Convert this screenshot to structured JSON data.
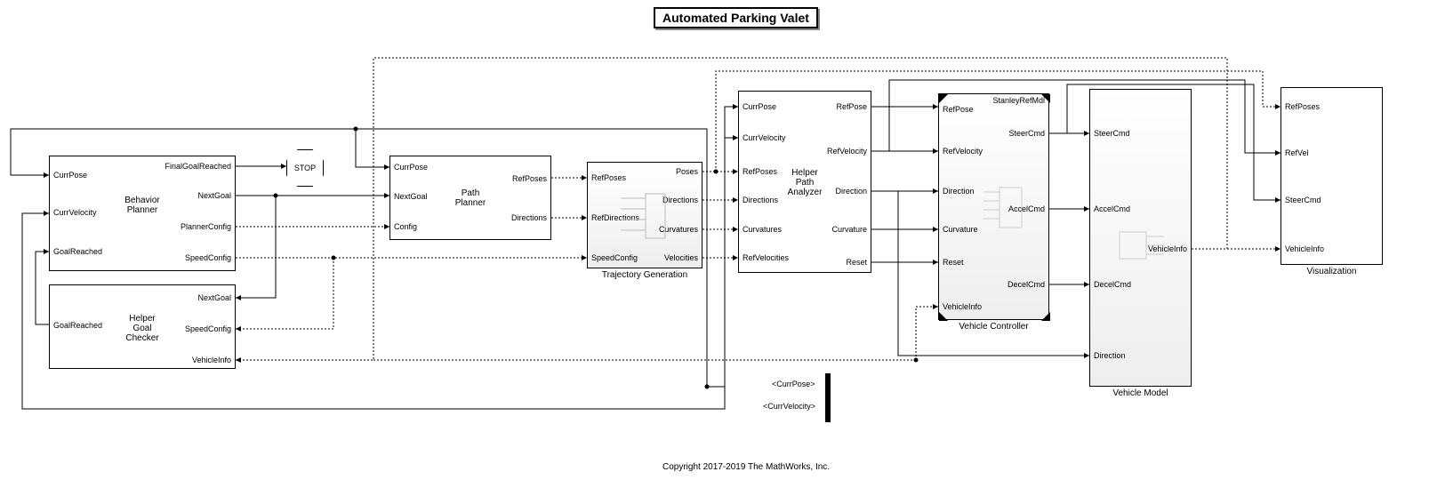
{
  "title": "Automated Parking Valet",
  "copyright": "Copyright 2017-2019 The MathWorks, Inc.",
  "stop": "STOP",
  "bussel": {
    "currpose": "<CurrPose>",
    "currvel": "<CurrVelocity>"
  },
  "blocks": {
    "behavior": {
      "name": "Behavior\nPlanner",
      "in": [
        "CurrPose",
        "CurrVelocity",
        "GoalReached"
      ],
      "out": [
        "FinalGoalReached",
        "NextGoal",
        "PlannerConfig",
        "SpeedConfig"
      ]
    },
    "goalchecker": {
      "name": "Helper\nGoal\nChecker",
      "in": [
        "GoalReached"
      ],
      "out": [
        "NextGoal",
        "SpeedConfig",
        "VehicleInfo"
      ]
    },
    "pathplanner": {
      "name": "Path\nPlanner",
      "in": [
        "CurrPose",
        "NextGoal",
        "Config"
      ],
      "out": [
        "RefPoses",
        "Directions"
      ]
    },
    "trajgen": {
      "label": "Trajectory Generation",
      "in": [
        "RefPoses",
        "RefDirections",
        "SpeedConfig"
      ],
      "out": [
        "Poses",
        "Directions",
        "Curvatures",
        "Velocities"
      ]
    },
    "helperpath": {
      "name": "Helper\nPath\nAnalyzer",
      "in": [
        "CurrPose",
        "CurrVelocity",
        "RefPoses",
        "Directions",
        "Curvatures",
        "RefVelocities"
      ],
      "out": [
        "RefPose",
        "RefVelocity",
        "Direction",
        "Curvature",
        "Reset"
      ]
    },
    "vehctrl": {
      "label": "Vehicle Controller",
      "topref": "StanleyRefMdl",
      "in": [
        "RefPose",
        "RefVelocity",
        "Direction",
        "Curvature",
        "Reset",
        "VehicleInfo"
      ],
      "out": [
        "SteerCmd",
        "AccelCmd",
        "DecelCmd"
      ]
    },
    "vehmodel": {
      "label": "Vehicle Model",
      "in": [
        "SteerCmd",
        "AccelCmd",
        "DecelCmd",
        "Direction"
      ],
      "out": [
        "VehicleInfo"
      ]
    },
    "viz": {
      "label": "Visualization",
      "in": [
        "RefPoses",
        "RefVel",
        "SteerCmd",
        "VehicleInfo"
      ]
    }
  }
}
